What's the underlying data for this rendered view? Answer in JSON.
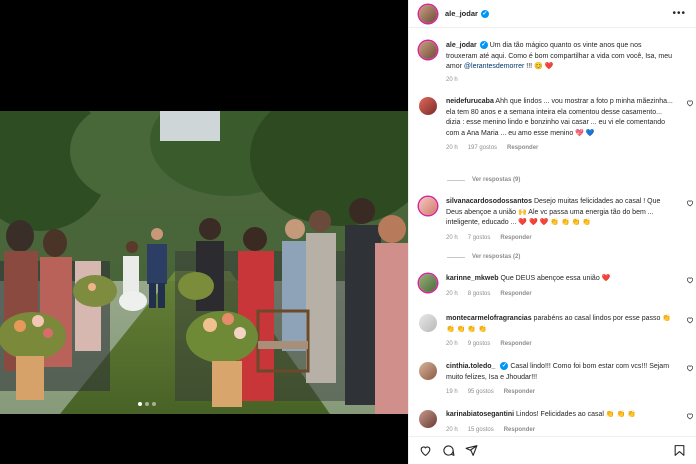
{
  "post": {
    "username": "ale_jodar",
    "more_icon": "ellipsis-icon"
  },
  "caption": {
    "username": "ale_jodar",
    "text": "Um dia tão mágico quanto os vinte anos que nos trouxeram até aqui. Como é bom compartilhar a vida com você, Isa, meu amor ",
    "mention": "@lerantesdemorrer",
    "suffix": " !!! 😊 ❤️",
    "time": "20 h"
  },
  "comments": [
    {
      "username": "neidefurucaba",
      "text": "Ahh que lindos ... vou mostrar a foto p minha mãezinha... ela tem 80 anos e a semana inteira ela comentou desse casamento... dizia : esse menino lindo e bonzinho vai casar ... eu vi ele comentando com a Ana Maria ... eu amo esse menino 💖 💙",
      "time": "20 h",
      "likes": "197 gostos",
      "reply": "Responder",
      "replies": "Ver respostas (9)"
    },
    {
      "username": "silvanacardosodossantos",
      "text": "Desejo muitas felicidades ao casal ! Que Deus abençoe a união 🙌 Ale vc passa uma energia tão do bem ... inteligente, educado ... ❤️ ❤️ ❤️ 👏 👏 👏 👏",
      "time": "20 h",
      "likes": "7 gostos",
      "reply": "Responder",
      "replies": "Ver respostas (2)"
    },
    {
      "username": "karinne_mkweb",
      "text": "Que DEUS abençoe essa união ❤️",
      "time": "20 h",
      "likes": "8 gostos",
      "reply": "Responder"
    },
    {
      "username": "montecarmelofragrancias",
      "text": "parabéns ao casal lindos por esse passo 👏 👏 👏 👏 👏",
      "time": "20 h",
      "likes": "9 gostos",
      "reply": "Responder"
    },
    {
      "username": "cinthia.toledo_",
      "text": "Casal lindo!!! Como foi bom estar com vcs!!! Sejam muito felizes, Isa e Jhoudar!!!",
      "time": "19 h",
      "likes": "95 gostos",
      "reply": "Responder"
    },
    {
      "username": "karinabiatosegantini",
      "text": "Lindos! Felicidades ao casal 👏 👏 👏",
      "time": "20 h",
      "likes": "15 gostos",
      "reply": "Responder"
    }
  ],
  "colors": {
    "verified": "#0095f6",
    "heart": "#ed4956",
    "meta": "#8e8e8e"
  }
}
